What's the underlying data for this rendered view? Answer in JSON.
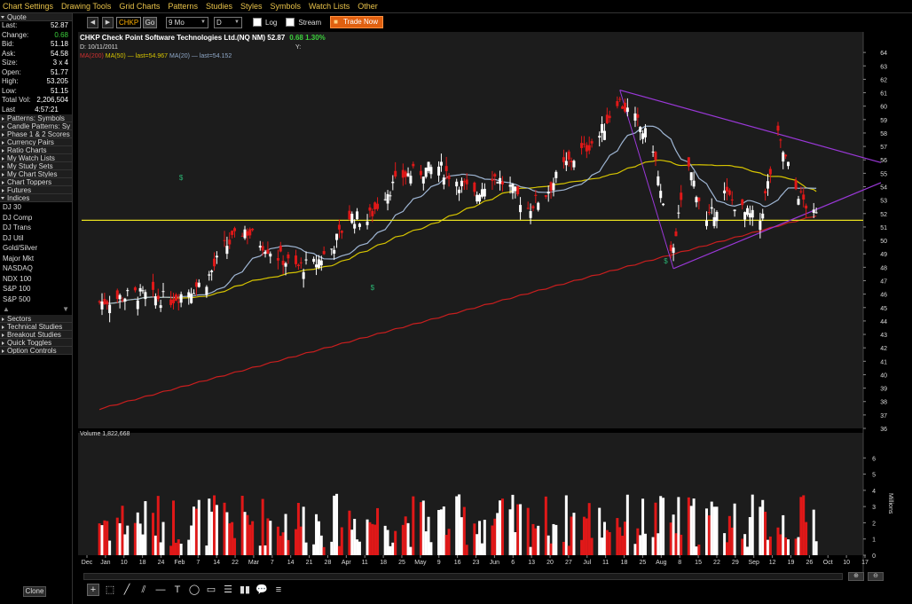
{
  "menu": [
    "Chart Settings",
    "Drawing Tools",
    "Grid Charts",
    "Patterns",
    "Studies",
    "Styles",
    "Symbols",
    "Watch Lists",
    "Other"
  ],
  "toolbar": {
    "back": "◀",
    "forward": "▶",
    "symbol": "CHKP",
    "go": "Go",
    "period": "9 Mo",
    "interval": "D",
    "log": "Log",
    "stream": "Stream",
    "trade": "Trade Now"
  },
  "quote": {
    "header": "Quote",
    "rows": [
      {
        "label": "Last:",
        "value": "52.87"
      },
      {
        "label": "Change:",
        "value": "0.68"
      },
      {
        "label": "Bid:",
        "value": "51.18"
      },
      {
        "label": "Ask:",
        "value": "54.58"
      },
      {
        "label": "Size:",
        "value": "3 x 4"
      },
      {
        "label": "Open:",
        "value": "51.77"
      },
      {
        "label": "High:",
        "value": "53.205"
      },
      {
        "label": "Low:",
        "value": "51.15"
      },
      {
        "label": "Total Vol:",
        "value": "2,206,504"
      },
      {
        "label": "Last Trade:",
        "value": "4:57:21 PM"
      }
    ]
  },
  "panels_top": [
    "Patterns: Symbols",
    "Candle Patterns: Sy",
    "Phase 1 & 2 Scores",
    "Currency Pairs",
    "Ratio Charts",
    "My Watch Lists",
    "My Study Sets",
    "My Chart Styles",
    "Chart Toppers",
    "Futures"
  ],
  "indices": {
    "header": "Indices",
    "items": [
      "DJ 30",
      "DJ Comp",
      "DJ Trans",
      "DJ Util",
      "Gold/Silver",
      "Major Mkt",
      "NASDAQ",
      "NDX 100",
      "S&P 100",
      "S&P 500"
    ]
  },
  "panels_bottom": [
    "Sectors",
    "Technical Studies",
    "Breakout Studies",
    "Quick Toggles",
    "Option Controls"
  ],
  "clone": "Clone",
  "chart": {
    "title": "CHKP Check Point Software Technologies Ltd.(NQ NM)  52.87",
    "change": "0.68  1.30%",
    "date": "D: 10/11/2011",
    "y_label": "Y:",
    "ma200": "MA(200)",
    "ma50": "MA(50) — last=54.967",
    "ma20": "MA(20) — last=54.152",
    "volume_label": "Volume 1,822,668",
    "millions": "Millions"
  },
  "colors": {
    "up": "#ffffff",
    "down": "#e01818",
    "ma200": "#c81e1e",
    "ma50": "#d6c400",
    "ma20": "#9fb6d4",
    "support": "#e8e020",
    "triangle": "#9a38d8",
    "dividend": "#2bb573"
  },
  "tools": [
    "crosshair",
    "select",
    "pen",
    "channel",
    "hline",
    "text",
    "ellipse",
    "rectangle",
    "fibonacci",
    "bars",
    "speech",
    "more"
  ],
  "chart_data": {
    "type": "candlestick",
    "title": "CHKP Check Point Software Technologies Ltd.(NQ NM)",
    "ylim": [
      36,
      65
    ],
    "y_ticks": [
      36,
      37,
      38,
      39,
      40,
      41,
      42,
      43,
      44,
      45,
      46,
      47,
      48,
      49,
      50,
      51,
      52,
      53,
      54,
      55,
      56,
      57,
      58,
      59,
      60,
      61,
      62,
      63,
      64
    ],
    "x_tick_labels": [
      "Dec",
      "Jan",
      "10",
      "18",
      "24",
      "Feb",
      "7",
      "14",
      "22",
      "Mar",
      "7",
      "14",
      "21",
      "28",
      "Apr",
      "11",
      "18",
      "25",
      "May",
      "9",
      "16",
      "23",
      "Jun",
      "6",
      "13",
      "20",
      "27",
      "Jul",
      "11",
      "18",
      "25",
      "Aug",
      "8",
      "15",
      "22",
      "29",
      "Sep",
      "12",
      "19",
      "26",
      "Oct",
      "10",
      "17"
    ],
    "support_level": 51.5,
    "close_anchors": [
      {
        "date": "2010-12-27",
        "close": 45.4
      },
      {
        "date": "2011-01-10",
        "close": 46.0
      },
      {
        "date": "2011-01-24",
        "close": 45.6
      },
      {
        "date": "2011-02-07",
        "close": 47.0
      },
      {
        "date": "2011-02-14",
        "close": 49.5
      },
      {
        "date": "2011-02-22",
        "close": 50.8
      },
      {
        "date": "2011-03-07",
        "close": 48.8
      },
      {
        "date": "2011-03-14",
        "close": 48.0
      },
      {
        "date": "2011-03-21",
        "close": 48.2
      },
      {
        "date": "2011-03-28",
        "close": 49.4
      },
      {
        "date": "2011-04-04",
        "close": 51.8
      },
      {
        "date": "2011-04-11",
        "close": 51.5
      },
      {
        "date": "2011-04-18",
        "close": 53.5
      },
      {
        "date": "2011-04-25",
        "close": 54.8
      },
      {
        "date": "2011-05-09",
        "close": 55.5
      },
      {
        "date": "2011-05-16",
        "close": 54.5
      },
      {
        "date": "2011-05-23",
        "close": 53.3
      },
      {
        "date": "2011-05-30",
        "close": 54.9
      },
      {
        "date": "2011-06-06",
        "close": 53.9
      },
      {
        "date": "2011-06-13",
        "close": 52.4
      },
      {
        "date": "2011-06-20",
        "close": 53.5
      },
      {
        "date": "2011-06-27",
        "close": 55.5
      },
      {
        "date": "2011-07-11",
        "close": 57.8
      },
      {
        "date": "2011-07-18",
        "close": 60.5
      },
      {
        "date": "2011-07-25",
        "close": 59.0
      },
      {
        "date": "2011-08-01",
        "close": 57.0
      },
      {
        "date": "2011-08-08",
        "close": 48.8
      },
      {
        "date": "2011-08-15",
        "close": 55.5
      },
      {
        "date": "2011-08-22",
        "close": 51.3
      },
      {
        "date": "2011-08-29",
        "close": 53.5
      },
      {
        "date": "2011-09-06",
        "close": 52.0
      },
      {
        "date": "2011-09-12",
        "close": 51.5
      },
      {
        "date": "2011-09-19",
        "close": 57.7
      },
      {
        "date": "2011-09-26",
        "close": 53.8
      },
      {
        "date": "2011-10-03",
        "close": 51.8
      }
    ],
    "volume_ylim": [
      0,
      7
    ],
    "volume_ticks": [
      0,
      1,
      2,
      3,
      4,
      5,
      6
    ]
  }
}
